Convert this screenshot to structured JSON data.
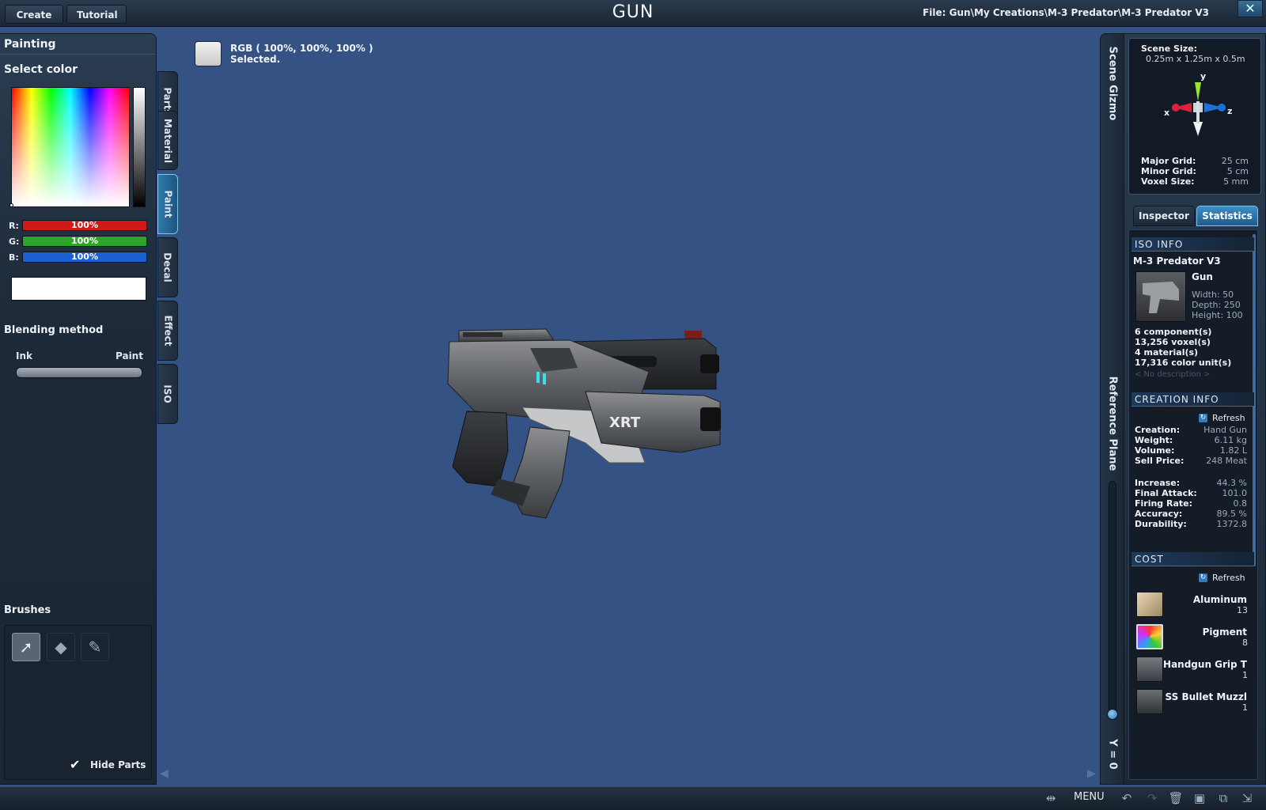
{
  "top": {
    "create_label": "Create",
    "tutorial_label": "Tutorial",
    "app_title": "GUN",
    "file_path": "File:  Gun\\My Creations\\M-3 Predator\\M-3 Predator V3",
    "close_glyph": "✕"
  },
  "left": {
    "section_title": "Painting",
    "select_color": "Select color",
    "channels": [
      {
        "label": "R:",
        "value": "100%",
        "color": "#cf1a1a"
      },
      {
        "label": "G:",
        "value": "100%",
        "color": "#2ba62b"
      },
      {
        "label": "B:",
        "value": "100%",
        "color": "#1b5fd0"
      }
    ],
    "swatch_color": "#ffffff",
    "blending_title": "Blending method",
    "blend_left": "Ink",
    "blend_right": "Paint",
    "brushes_title": "Brushes",
    "brush_icons": [
      "pointer-icon",
      "eraser-icon",
      "brush-icon"
    ],
    "hide_parts_label": "Hide Parts",
    "hide_parts_checked": true
  },
  "tabs": [
    {
      "label": "Parts",
      "active": false
    },
    {
      "label": "Material",
      "active": false
    },
    {
      "label": "Paint",
      "active": true
    },
    {
      "label": "Decal",
      "active": false
    },
    {
      "label": "Effect",
      "active": false
    },
    {
      "label": "ISO",
      "active": false
    }
  ],
  "viewport": {
    "rgb_line": "RGB ( 100%, 100%, 100% )",
    "status_line": "Selected.",
    "background": "#345283"
  },
  "right_strip": {
    "scene_gizmo_label": "Scene Gizmo",
    "reference_plane_label": "Reference Plane",
    "y_label": "Y = 0"
  },
  "gizmo": {
    "scene_size_label": "Scene Size:",
    "scene_size_value": "0.25m x 1.25m x 0.5m",
    "axis_x": "x",
    "axis_y": "y",
    "axis_z": "z",
    "grid": [
      {
        "label": "Major Grid:",
        "value": "25 cm"
      },
      {
        "label": "Minor Grid:",
        "value": "5 cm"
      },
      {
        "label": "Voxel Size:",
        "value": "5 mm"
      }
    ]
  },
  "right_tabs": {
    "inspector": "Inspector",
    "statistics": "Statistics",
    "active": "statistics"
  },
  "iso_info": {
    "header": "ISO INFO",
    "name": "M-3 Predator V3",
    "category": "Gun",
    "dims": [
      {
        "label": "Width:",
        "value": "50"
      },
      {
        "label": "Depth:",
        "value": "250"
      },
      {
        "label": "Height:",
        "value": "100"
      }
    ],
    "counts": [
      "6 component(s)",
      "13,256 voxel(s)",
      "4 material(s)",
      "17,316 color unit(s)"
    ],
    "description": "< No description >"
  },
  "creation_info": {
    "header": "CREATION INFO",
    "refresh_label": "Refresh",
    "stats_a": [
      {
        "label": "Creation:",
        "value": "Hand Gun"
      },
      {
        "label": "Weight:",
        "value": "6.11 kg"
      },
      {
        "label": "Volume:",
        "value": "1.82 L"
      },
      {
        "label": "Sell Price:",
        "value": "248 Meat"
      }
    ],
    "stats_b": [
      {
        "label": "Increase:",
        "value": "44.3 %"
      },
      {
        "label": "Final Attack:",
        "value": "101.0"
      },
      {
        "label": "Firing Rate:",
        "value": "0.8"
      },
      {
        "label": "Accuracy:",
        "value": "89.5 %"
      },
      {
        "label": "Durability:",
        "value": "1372.8"
      }
    ]
  },
  "cost": {
    "header": "COST",
    "refresh_label": "Refresh",
    "items": [
      {
        "name": "Aluminum",
        "qty": "13"
      },
      {
        "name": "Pigment",
        "qty": "8"
      },
      {
        "name": "Handgun Grip T",
        "qty": "1"
      },
      {
        "name": "SS Bullet Muzzl",
        "qty": "1"
      }
    ]
  },
  "bottom": {
    "menu_label": "MENU"
  }
}
